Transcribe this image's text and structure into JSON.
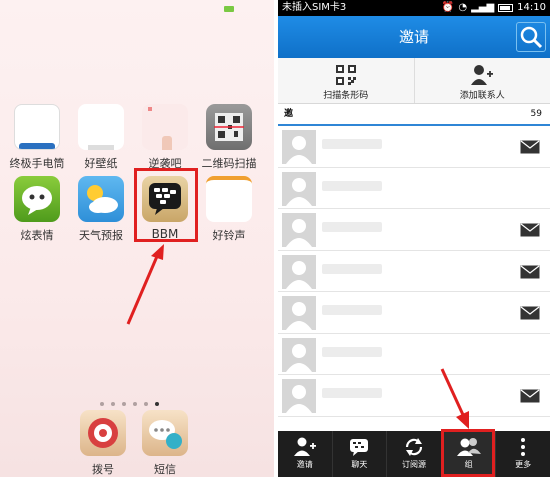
{
  "home": {
    "apps_row1": [
      {
        "label": "终极手电筒",
        "icon": "flashlight-icon"
      },
      {
        "label": "好壁纸",
        "icon": "wallpaper-icon"
      },
      {
        "label": "逆袭吧",
        "icon": "app-icon"
      },
      {
        "label": "二维码扫描",
        "icon": "qrcode-scanner-icon"
      }
    ],
    "apps_row2": [
      {
        "label": "炫表情",
        "icon": "emoji-icon"
      },
      {
        "label": "天气预报",
        "icon": "weather-icon"
      },
      {
        "label": "BBM",
        "icon": "bbm-icon"
      },
      {
        "label": "好铃声",
        "icon": "ringtone-icon"
      }
    ],
    "dock": [
      {
        "label": "拨号",
        "icon": "dialer-icon"
      },
      {
        "label": "短信",
        "icon": "sms-icon"
      }
    ],
    "page_count": 6,
    "active_page": 6
  },
  "phone": {
    "status": {
      "carrier": "未插入SIM卡3",
      "time": "14:10"
    },
    "title": "邀请",
    "actions": [
      {
        "label": "扫描条形码",
        "icon": "qrcode-icon"
      },
      {
        "label": "添加联系人",
        "icon": "add-contact-icon"
      }
    ],
    "group": {
      "name": "邀",
      "count": "59"
    },
    "nav": [
      {
        "label": "邀请",
        "icon": "invite-icon"
      },
      {
        "label": "聊天",
        "icon": "chat-icon"
      },
      {
        "label": "订阅源",
        "icon": "feed-icon"
      },
      {
        "label": "组",
        "icon": "group-icon"
      },
      {
        "label": "更多",
        "icon": "more-icon"
      }
    ],
    "accent": "#1a7fd9"
  }
}
